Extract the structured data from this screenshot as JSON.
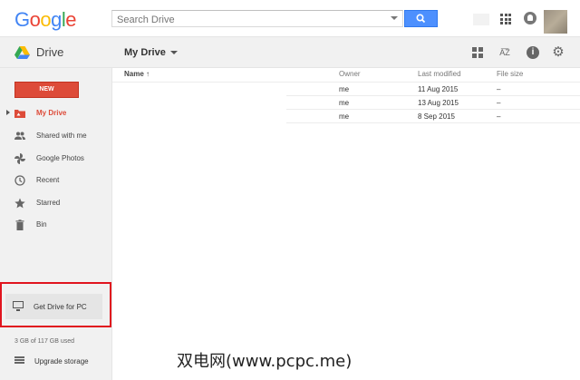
{
  "header": {
    "logo_letters": [
      "G",
      "o",
      "o",
      "g",
      "l",
      "e"
    ],
    "search_placeholder": "Search Drive"
  },
  "subbar": {
    "app_name": "Drive",
    "location": "My Drive"
  },
  "sidebar": {
    "new_label": "NEW",
    "items": [
      {
        "label": "My Drive",
        "icon": "folder-icon",
        "active": true
      },
      {
        "label": "Shared with me",
        "icon": "people-icon"
      },
      {
        "label": "Google Photos",
        "icon": "pinwheel-icon"
      },
      {
        "label": "Recent",
        "icon": "clock-icon"
      },
      {
        "label": "Starred",
        "icon": "star-icon"
      },
      {
        "label": "Bin",
        "icon": "trash-icon"
      }
    ],
    "get_drive_label": "Get Drive for PC",
    "storage_text": "3 GB of 117 GB used",
    "upgrade_label": "Upgrade storage"
  },
  "table": {
    "columns": {
      "name": "Name ↑",
      "owner": "Owner",
      "modified": "Last modified",
      "size": "File size"
    },
    "rows": [
      {
        "owner": "me",
        "modified": "11 Aug 2015",
        "size": "–"
      },
      {
        "owner": "me",
        "modified": "13 Aug 2015",
        "size": "–"
      },
      {
        "owner": "me",
        "modified": "8 Sep 2015",
        "size": "–"
      }
    ]
  },
  "watermark": "双电网(www.pcpc.me)",
  "colors": {
    "accent_red": "#dd4b39",
    "search_blue": "#4d90fe",
    "highlight_box": "#e0141e"
  }
}
